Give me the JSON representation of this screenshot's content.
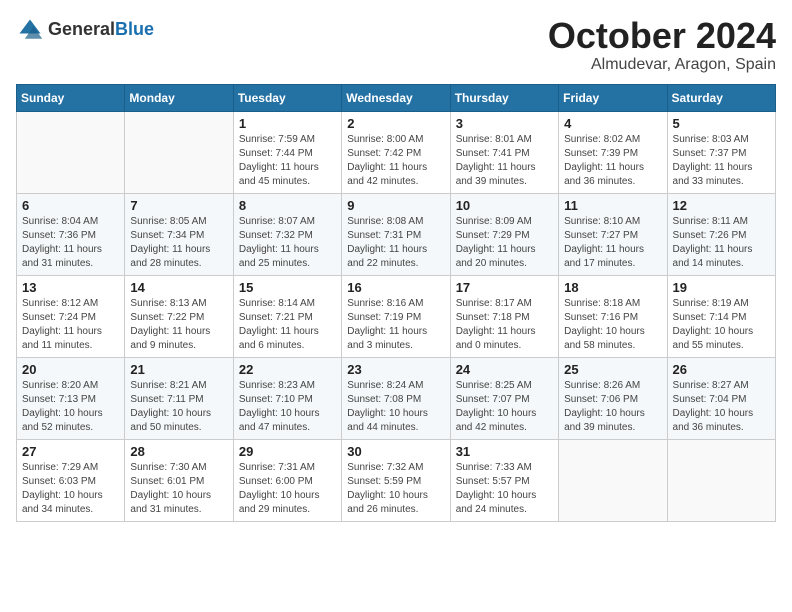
{
  "logo": {
    "general": "General",
    "blue": "Blue"
  },
  "header": {
    "month": "October 2024",
    "location": "Almudevar, Aragon, Spain"
  },
  "weekdays": [
    "Sunday",
    "Monday",
    "Tuesday",
    "Wednesday",
    "Thursday",
    "Friday",
    "Saturday"
  ],
  "weeks": [
    [
      {
        "day": "",
        "info": ""
      },
      {
        "day": "",
        "info": ""
      },
      {
        "day": "1",
        "info": "Sunrise: 7:59 AM\nSunset: 7:44 PM\nDaylight: 11 hours and 45 minutes."
      },
      {
        "day": "2",
        "info": "Sunrise: 8:00 AM\nSunset: 7:42 PM\nDaylight: 11 hours and 42 minutes."
      },
      {
        "day": "3",
        "info": "Sunrise: 8:01 AM\nSunset: 7:41 PM\nDaylight: 11 hours and 39 minutes."
      },
      {
        "day": "4",
        "info": "Sunrise: 8:02 AM\nSunset: 7:39 PM\nDaylight: 11 hours and 36 minutes."
      },
      {
        "day": "5",
        "info": "Sunrise: 8:03 AM\nSunset: 7:37 PM\nDaylight: 11 hours and 33 minutes."
      }
    ],
    [
      {
        "day": "6",
        "info": "Sunrise: 8:04 AM\nSunset: 7:36 PM\nDaylight: 11 hours and 31 minutes."
      },
      {
        "day": "7",
        "info": "Sunrise: 8:05 AM\nSunset: 7:34 PM\nDaylight: 11 hours and 28 minutes."
      },
      {
        "day": "8",
        "info": "Sunrise: 8:07 AM\nSunset: 7:32 PM\nDaylight: 11 hours and 25 minutes."
      },
      {
        "day": "9",
        "info": "Sunrise: 8:08 AM\nSunset: 7:31 PM\nDaylight: 11 hours and 22 minutes."
      },
      {
        "day": "10",
        "info": "Sunrise: 8:09 AM\nSunset: 7:29 PM\nDaylight: 11 hours and 20 minutes."
      },
      {
        "day": "11",
        "info": "Sunrise: 8:10 AM\nSunset: 7:27 PM\nDaylight: 11 hours and 17 minutes."
      },
      {
        "day": "12",
        "info": "Sunrise: 8:11 AM\nSunset: 7:26 PM\nDaylight: 11 hours and 14 minutes."
      }
    ],
    [
      {
        "day": "13",
        "info": "Sunrise: 8:12 AM\nSunset: 7:24 PM\nDaylight: 11 hours and 11 minutes."
      },
      {
        "day": "14",
        "info": "Sunrise: 8:13 AM\nSunset: 7:22 PM\nDaylight: 11 hours and 9 minutes."
      },
      {
        "day": "15",
        "info": "Sunrise: 8:14 AM\nSunset: 7:21 PM\nDaylight: 11 hours and 6 minutes."
      },
      {
        "day": "16",
        "info": "Sunrise: 8:16 AM\nSunset: 7:19 PM\nDaylight: 11 hours and 3 minutes."
      },
      {
        "day": "17",
        "info": "Sunrise: 8:17 AM\nSunset: 7:18 PM\nDaylight: 11 hours and 0 minutes."
      },
      {
        "day": "18",
        "info": "Sunrise: 8:18 AM\nSunset: 7:16 PM\nDaylight: 10 hours and 58 minutes."
      },
      {
        "day": "19",
        "info": "Sunrise: 8:19 AM\nSunset: 7:14 PM\nDaylight: 10 hours and 55 minutes."
      }
    ],
    [
      {
        "day": "20",
        "info": "Sunrise: 8:20 AM\nSunset: 7:13 PM\nDaylight: 10 hours and 52 minutes."
      },
      {
        "day": "21",
        "info": "Sunrise: 8:21 AM\nSunset: 7:11 PM\nDaylight: 10 hours and 50 minutes."
      },
      {
        "day": "22",
        "info": "Sunrise: 8:23 AM\nSunset: 7:10 PM\nDaylight: 10 hours and 47 minutes."
      },
      {
        "day": "23",
        "info": "Sunrise: 8:24 AM\nSunset: 7:08 PM\nDaylight: 10 hours and 44 minutes."
      },
      {
        "day": "24",
        "info": "Sunrise: 8:25 AM\nSunset: 7:07 PM\nDaylight: 10 hours and 42 minutes."
      },
      {
        "day": "25",
        "info": "Sunrise: 8:26 AM\nSunset: 7:06 PM\nDaylight: 10 hours and 39 minutes."
      },
      {
        "day": "26",
        "info": "Sunrise: 8:27 AM\nSunset: 7:04 PM\nDaylight: 10 hours and 36 minutes."
      }
    ],
    [
      {
        "day": "27",
        "info": "Sunrise: 7:29 AM\nSunset: 6:03 PM\nDaylight: 10 hours and 34 minutes."
      },
      {
        "day": "28",
        "info": "Sunrise: 7:30 AM\nSunset: 6:01 PM\nDaylight: 10 hours and 31 minutes."
      },
      {
        "day": "29",
        "info": "Sunrise: 7:31 AM\nSunset: 6:00 PM\nDaylight: 10 hours and 29 minutes."
      },
      {
        "day": "30",
        "info": "Sunrise: 7:32 AM\nSunset: 5:59 PM\nDaylight: 10 hours and 26 minutes."
      },
      {
        "day": "31",
        "info": "Sunrise: 7:33 AM\nSunset: 5:57 PM\nDaylight: 10 hours and 24 minutes."
      },
      {
        "day": "",
        "info": ""
      },
      {
        "day": "",
        "info": ""
      }
    ]
  ]
}
